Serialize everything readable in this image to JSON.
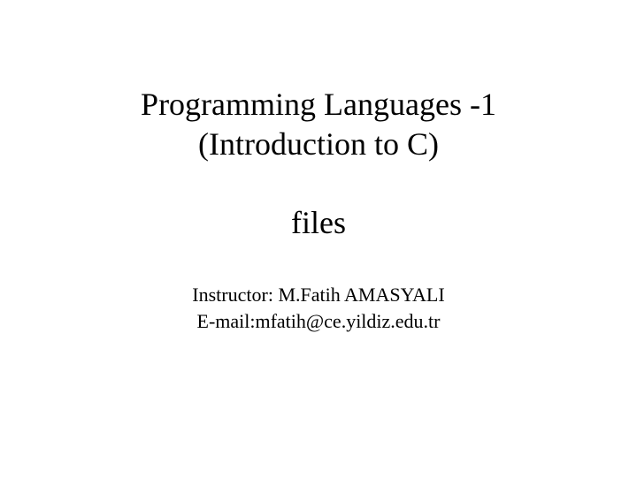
{
  "title": {
    "line1": "Programming Languages -1",
    "line2": "(Introduction to C)",
    "line3": "files"
  },
  "subtitle": {
    "instructor": "Instructor: M.Fatih AMASYALI",
    "email": "E-mail:mfatih@ce.yildiz.edu.tr"
  }
}
